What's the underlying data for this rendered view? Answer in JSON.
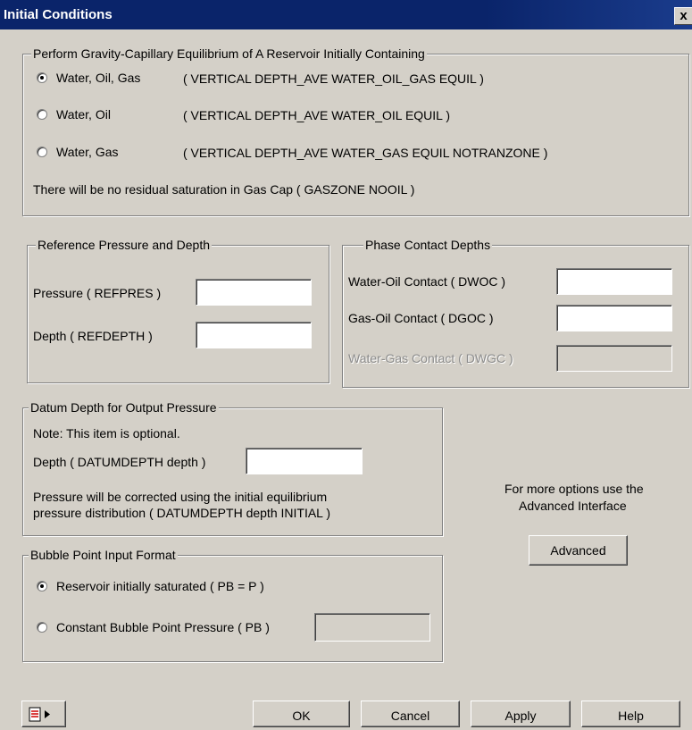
{
  "window": {
    "title": "Initial Conditions",
    "close_glyph": "x"
  },
  "equilibrium": {
    "legend": "Perform Gravity-Capillary Equilibrium of A Reservoir Initially Containing",
    "options": [
      {
        "label": "Water, Oil, Gas",
        "keyword": "( VERTICAL DEPTH_AVE WATER_OIL_GAS EQUIL )",
        "selected": true
      },
      {
        "label": "Water, Oil",
        "keyword": "( VERTICAL DEPTH_AVE WATER_OIL EQUIL )",
        "selected": false
      },
      {
        "label": "Water, Gas",
        "keyword": "( VERTICAL DEPTH_AVE WATER_GAS EQUIL NOTRANZONE )",
        "selected": false
      }
    ],
    "note": "There will be no residual saturation in Gas Cap ( GASZONE NOOIL )"
  },
  "reference": {
    "legend": "Reference Pressure and Depth",
    "pressure_label": "Pressure ( REFPRES )",
    "pressure_value": "",
    "depth_label": "Depth ( REFDEPTH )",
    "depth_value": ""
  },
  "contacts": {
    "legend": "Phase Contact Depths",
    "dwoc_label": "Water-Oil Contact ( DWOC )",
    "dwoc_value": "",
    "dgoc_label": "Gas-Oil Contact ( DGOC )",
    "dgoc_value": "",
    "dwgc_label": "Water-Gas Contact ( DWGC )",
    "dwgc_value": ""
  },
  "datum": {
    "legend": "Datum Depth for Output Pressure",
    "note": "Note: This item is optional.",
    "depth_label": "Depth ( DATUMDEPTH depth )",
    "depth_value": "",
    "info_line1": "Pressure will be corrected using the initial equilibrium",
    "info_line2": "pressure distribution ( DATUMDEPTH depth INITIAL )"
  },
  "bubble": {
    "legend": "Bubble Point Input Format",
    "option1": "Reservoir initially saturated ( PB = P )",
    "option1_selected": true,
    "option2": "Constant Bubble Point Pressure ( PB )",
    "option2_selected": false,
    "pb_value": ""
  },
  "advanced": {
    "text_line1": "For more options use the",
    "text_line2": "Advanced Interface",
    "button": "Advanced"
  },
  "footer": {
    "tool_icon": "notepad-arrow-icon",
    "ok": "OK",
    "cancel": "Cancel",
    "apply": "Apply",
    "help": "Help"
  }
}
